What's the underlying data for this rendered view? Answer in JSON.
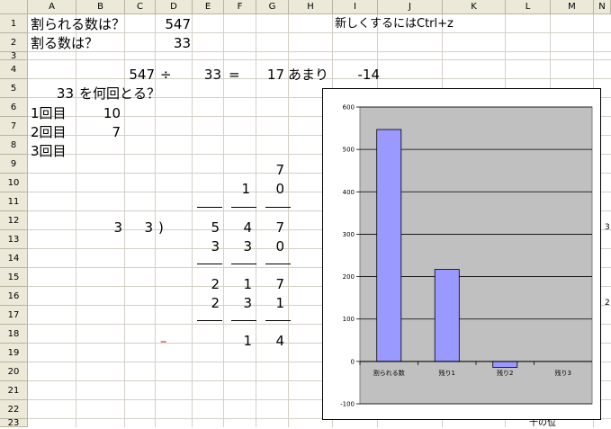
{
  "columns": [
    "A",
    "B",
    "C",
    "D",
    "E",
    "F",
    "G",
    "H",
    "I",
    "J",
    "K",
    "L",
    "M",
    "N"
  ],
  "rows": [
    "1",
    "2",
    "3",
    "4",
    "5",
    "6",
    "7",
    "8",
    "9",
    "10",
    "11",
    "12",
    "13",
    "14",
    "15",
    "16",
    "17",
    "18",
    "19",
    "20",
    "21",
    "22",
    "23"
  ],
  "cells": {
    "a1": "割られる数は？",
    "d1": "547",
    "i1": "新しくするにはCtrl+z",
    "a2": "割る数は？",
    "d2": "33",
    "c4": "547",
    "d4": "÷",
    "e4": "33",
    "f4": "=",
    "g4": "17",
    "h4": "あまり",
    "i4": "-14",
    "a5": "33",
    "b5": "を何回とる？",
    "a6": "1回目",
    "b6": "10",
    "a7": "2回目",
    "b7": "7",
    "a8": "3回目",
    "g9": "7",
    "f10": "1",
    "g10": "0",
    "b12": "3",
    "c12": "3",
    "d12": ")",
    "e12": "5",
    "f12": "4",
    "g12": "7",
    "e13": "3",
    "f13": "3",
    "g13": "0",
    "e15": "2",
    "f15": "1",
    "g15": "7",
    "e16": "2",
    "f16": "3",
    "g16": "1",
    "d18": "–",
    "f18": "1",
    "g18": "4",
    "n12": "3",
    "n16": "2",
    "m23": "十の位"
  },
  "chart_data": {
    "type": "bar",
    "categories": [
      "割られる数",
      "残り1",
      "残り2",
      "残り3"
    ],
    "values": [
      547,
      217,
      -14,
      0
    ],
    "ylim": [
      -100,
      600
    ],
    "yticks": [
      -100,
      0,
      100,
      200,
      300,
      400,
      500,
      600
    ],
    "grid": true,
    "bar_color": "#9999ff",
    "plot_bg": "#c0c0c0"
  }
}
